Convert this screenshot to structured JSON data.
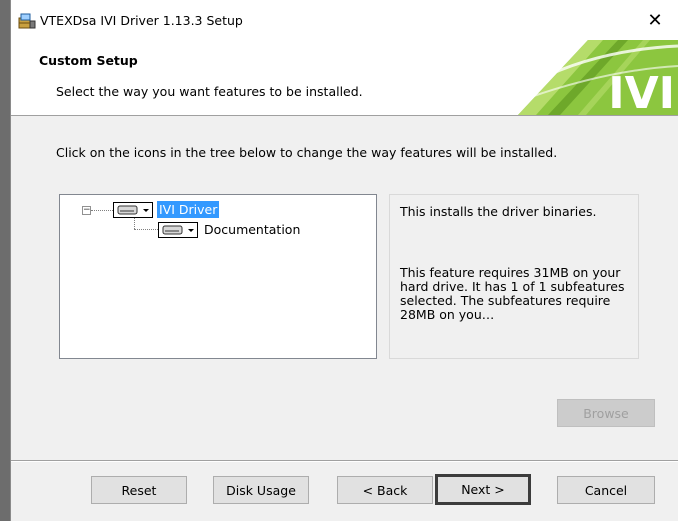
{
  "titlebar": {
    "title": "VTEXDsa IVI Driver 1.13.3 Setup",
    "close_glyph": "✕"
  },
  "banner": {
    "heading": "Custom Setup",
    "subtitle": "Select the way you want features to be installed.",
    "logo_text": "IVI",
    "logo_color": "#8cc63f"
  },
  "instructions": "Click on the icons in the tree below to change the way features will be installed.",
  "tree": {
    "items": [
      {
        "label": "IVI Driver",
        "icon": "hard-drive-icon",
        "selected": true
      },
      {
        "label": "Documentation",
        "icon": "hard-drive-icon",
        "selected": false
      }
    ]
  },
  "description": {
    "line1": "This installs the driver binaries.",
    "line2": "This feature requires 31MB on your hard drive. It has 1 of 1 subfeatures selected. The subfeatures require 28MB on you…"
  },
  "buttons": {
    "browse": "Browse",
    "reset": "Reset",
    "disk_usage": "Disk Usage",
    "back": "< Back",
    "next": "Next >",
    "cancel": "Cancel"
  },
  "colors": {
    "selection": "#3399ff",
    "window_bg": "#f0f0f0"
  }
}
